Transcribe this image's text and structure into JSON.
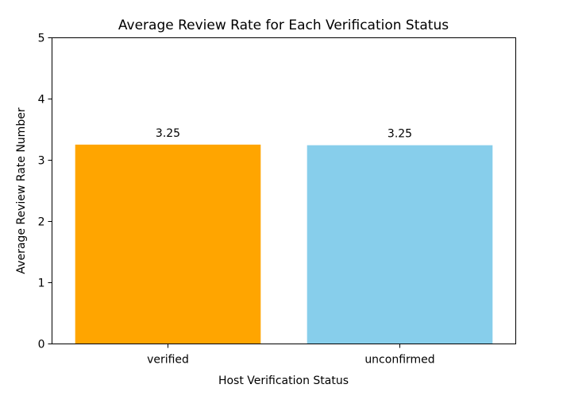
{
  "chart_data": {
    "type": "bar",
    "title": "Average Review Rate for Each Verification Status",
    "xlabel": "Host Verification Status",
    "ylabel": "Average Review Rate Number",
    "categories": [
      "verified",
      "unconfirmed"
    ],
    "values": [
      3.255,
      3.245
    ],
    "data_labels": [
      "3.25",
      "3.25"
    ],
    "colors": [
      "#FFA500",
      "#87CEEB"
    ],
    "ylim": [
      0,
      5
    ],
    "yticks": [
      "0",
      "1",
      "2",
      "3",
      "4",
      "5"
    ],
    "grid": false
  }
}
